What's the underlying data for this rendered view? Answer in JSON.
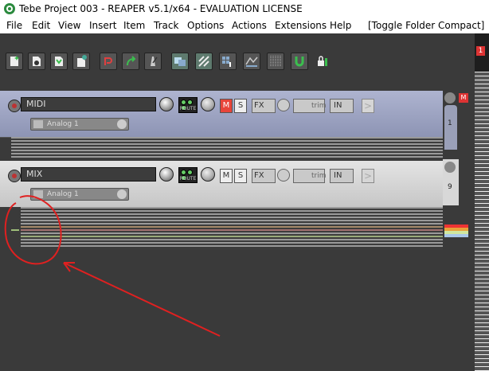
{
  "window": {
    "title": "Tebe Project 003 - REAPER v5.1/x64 - EVALUATION LICENSE"
  },
  "menu": [
    "File",
    "Edit",
    "View",
    "Insert",
    "Item",
    "Track",
    "Options",
    "Actions",
    "Extensions",
    "Help",
    "[Toggle Folder Compact]"
  ],
  "toolbar": {
    "icons": [
      "new-project-icon",
      "open-project-icon",
      "save-project-icon",
      "project-settings-icon",
      "undo-icon",
      "redo-icon",
      "metronome-icon",
      "auto-crossfade-icon",
      "ripple-edit-icon",
      "grid-icon",
      "envelope-points-icon",
      "snap-grid-icon",
      "snap-icon",
      "lock-icon"
    ]
  },
  "tracks": [
    {
      "name": "MIDI",
      "route_label": "ROUTE",
      "mute": "M",
      "solo": "S",
      "fx": "FX",
      "env": "trim",
      "input": "IN",
      "fx_slot": "Analog 1",
      "mute_on": true,
      "color": "#9aa0c0"
    },
    {
      "name": "MIX",
      "route_label": "ROUTE",
      "mute": "M",
      "solo": "S",
      "fx": "FX",
      "env": "trim",
      "input": "IN",
      "fx_slot": "Analog 1",
      "mute_on": false,
      "color": "#d8d8d8"
    }
  ],
  "mixer": {
    "midi_channel": "1",
    "mix_channel": "9",
    "master_mute": "M",
    "marker": "1"
  },
  "colors": {
    "annotation": "#e02020",
    "accent_green": "#3bbf4e"
  }
}
